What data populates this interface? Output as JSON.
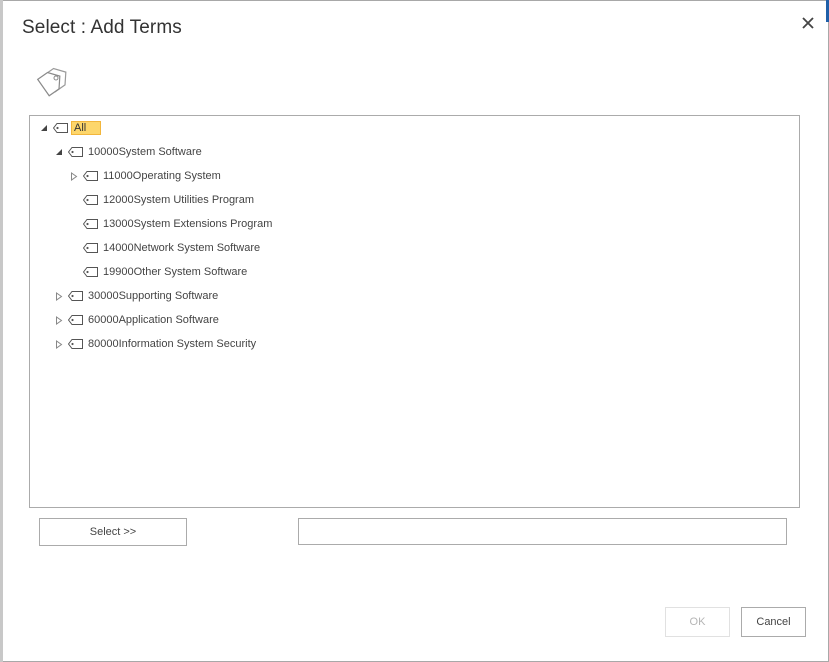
{
  "dialog": {
    "title": "Select : Add Terms",
    "close_icon": "close-icon",
    "logo_icon": "tags-icon"
  },
  "tree": {
    "items": [
      {
        "label": "All",
        "level": 0,
        "toggle": "expanded",
        "selected": true
      },
      {
        "label": "10000System Software",
        "level": 1,
        "toggle": "expanded",
        "selected": false
      },
      {
        "label": "11000Operating System",
        "level": 2,
        "toggle": "collapsed",
        "selected": false
      },
      {
        "label": "12000System Utilities Program",
        "level": 2,
        "toggle": "none",
        "selected": false
      },
      {
        "label": "13000System Extensions Program",
        "level": 2,
        "toggle": "none",
        "selected": false
      },
      {
        "label": "14000Network System Software",
        "level": 2,
        "toggle": "none",
        "selected": false
      },
      {
        "label": "19900Other System Software",
        "level": 2,
        "toggle": "none",
        "selected": false
      },
      {
        "label": "30000Supporting Software",
        "level": 1,
        "toggle": "collapsed",
        "selected": false
      },
      {
        "label": "60000Application Software",
        "level": 1,
        "toggle": "collapsed",
        "selected": false
      },
      {
        "label": "80000Information System Security",
        "level": 1,
        "toggle": "collapsed",
        "selected": false
      }
    ]
  },
  "actions": {
    "select_label": "Select >>",
    "selected_value": "",
    "ok_label": "OK",
    "cancel_label": "Cancel"
  },
  "colors": {
    "selection_bg": "#fdd66b",
    "selection_border": "#f2b63c",
    "accent": "#1f5fa8"
  }
}
